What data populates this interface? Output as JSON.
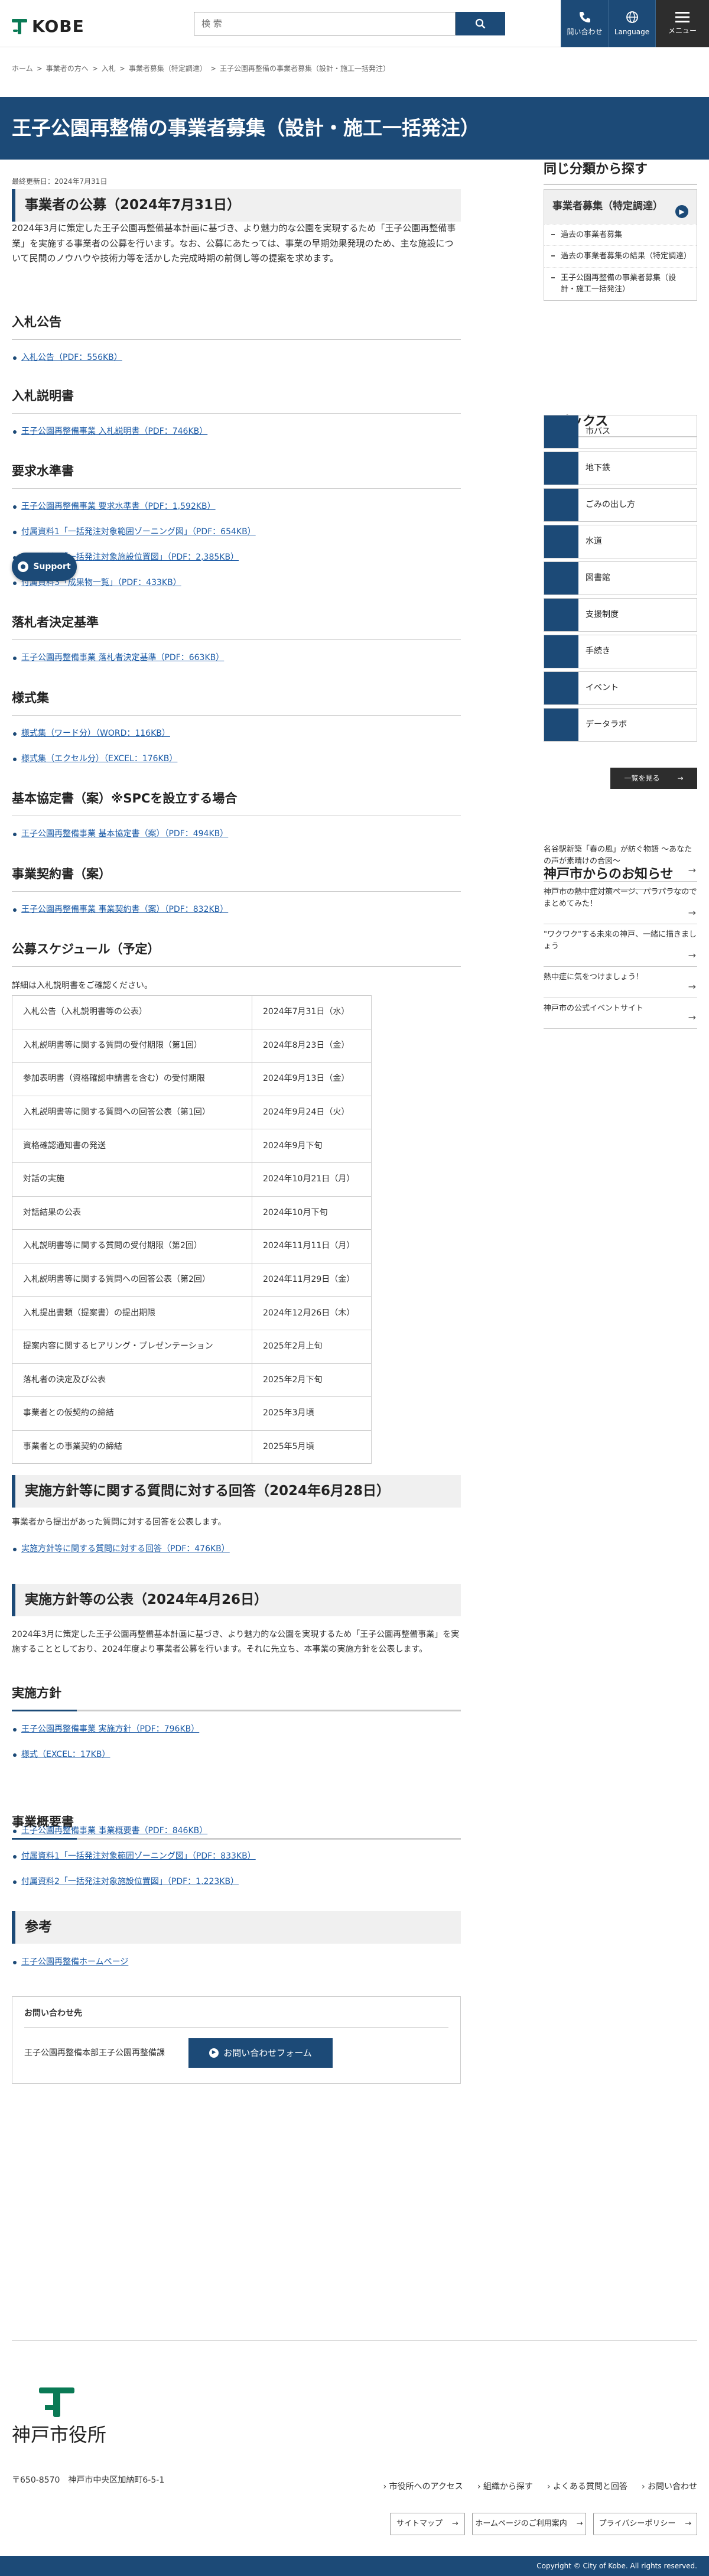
{
  "header": {
    "logo_text": "KOBE",
    "search_placeholder": "検 索",
    "buttons": [
      {
        "label": "問い合わせ",
        "icon": "phone-icon"
      },
      {
        "label": "Language",
        "icon": "globe-icon"
      },
      {
        "label": "メニュー",
        "icon": "menu-icon"
      }
    ]
  },
  "breadcrumb": [
    "ホーム",
    "事業者の方へ",
    "入札",
    "事業者募集（特定調達）",
    "王子公園再整備の事業者募集（設計・施工一括発注）"
  ],
  "page_title": "王子公園再整備の事業者募集（設計・施工一括発注）",
  "updated": "最終更新日：2024年7月31日",
  "sec1": {
    "title": "事業者の公募（2024年7月31日）",
    "para": "2024年3月に策定した王子公園再整備基本計画に基づき、より魅力的な公園を実現するため「王子公園再整備事業」を実施する事業者の公募を行います。なお、公募にあたっては、事業の早期効果発現のため、主な施設について民間のノウハウや技術力等を活かした完成時期の前倒し等の提案を求めます。"
  },
  "nyusatsu": {
    "title": "入札公告",
    "links": [
      "入札公告（PDF：556KB）"
    ]
  },
  "setsumei": {
    "title": "入札説明書",
    "links": [
      "王子公園再整備事業 入札説明書（PDF：746KB）"
    ]
  },
  "yokyu": {
    "title": "要求水準書",
    "links": [
      "王子公園再整備事業 要求水準書（PDF：1,592KB）",
      "付属資料1「一括発注対象範囲ゾーニング図」（PDF：654KB）",
      "付属資料2「一括発注対象施設位置図」（PDF：2,385KB）",
      "付属資料3「成果物一覧」（PDF：433KB）"
    ]
  },
  "rakusatsu": {
    "title": "落札者決定基準",
    "links": [
      "王子公園再整備事業 落札者決定基準（PDF：663KB）"
    ]
  },
  "yoshiki": {
    "title": "様式集",
    "links": [
      "様式集（ワード分）（WORD：116KB）",
      "様式集（エクセル分）（EXCEL：176KB）"
    ]
  },
  "kihon": {
    "title": "基本協定書（案）※SPCを設立する場合",
    "links": [
      "王子公園再整備事業 基本協定書（案）（PDF：494KB）"
    ]
  },
  "keiyaku": {
    "title": "事業契約書（案）",
    "links": [
      "王子公園再整備事業 事業契約書（案）（PDF：832KB）"
    ]
  },
  "schedule": {
    "title": "公募スケジュール（予定）",
    "note": "詳細は入札説明書をご確認ください。",
    "rows": [
      [
        "入札公告（入札説明書等の公表）",
        "2024年7月31日（水）"
      ],
      [
        "入札説明書等に関する質問の受付期限（第1回）",
        "2024年8月23日（金）"
      ],
      [
        "参加表明書（資格確認申請書を含む）の受付期限",
        "2024年9月13日（金）"
      ],
      [
        "入札説明書等に関する質問への回答公表（第1回）",
        "2024年9月24日（火）"
      ],
      [
        "資格確認通知書の発送",
        "2024年9月下旬"
      ],
      [
        "対話の実施",
        "2024年10月21日（月）"
      ],
      [
        "対話結果の公表",
        "2024年10月下旬"
      ],
      [
        "入札説明書等に関する質問の受付期限（第2回）",
        "2024年11月11日（月）"
      ],
      [
        "入札説明書等に関する質問への回答公表（第2回）",
        "2024年11月29日（金）"
      ],
      [
        "入札提出書類（提案書）の提出期限",
        "2024年12月26日（木）"
      ],
      [
        "提案内容に関するヒアリング・プレゼンテーション",
        "2025年2月上旬"
      ],
      [
        "落札者の決定及び公表",
        "2025年2月下旬"
      ],
      [
        "事業者との仮契約の締結",
        "2025年3月頃"
      ],
      [
        "事業者との事業契約の締結",
        "2025年5月頃"
      ]
    ]
  },
  "sec2": {
    "title": "実施方針等に関する質問に対する回答（2024年6月28日）",
    "para": "事業者から提出があった質問に対する回答を公表します。",
    "links": [
      "実施方針等に関する質問に対する回答（PDF：476KB）"
    ]
  },
  "sec3": {
    "title": "実施方針等の公表（2024年4月26日）",
    "para": "2024年3月に策定した王子公園再整備基本計画に基づき、より魅力的な公園を実現するため「王子公園再整備事業」を実施することとしており、2024年度より事業者公募を行います。それに先立ち、本事業の実施方針を公表します。"
  },
  "hoshin": {
    "title": "実施方針",
    "links": [
      "王子公園再整備事業 実施方針（PDF：796KB）",
      "様式（EXCEL：17KB）"
    ]
  },
  "gaiyo": {
    "title": "事業概要書",
    "links": [
      "王子公園再整備事業 事業概要書（PDF：846KB）",
      "付属資料1「一括発注対象範囲ゾーニング図」（PDF：833KB）",
      "付属資料2「一括発注対象施設位置図」（PDF：1,223KB）"
    ]
  },
  "ref": {
    "title": "参考",
    "links": [
      "王子公園再整備ホームページ"
    ]
  },
  "contact": {
    "heading": "お問い合わせ先",
    "dept": "王子公園再整備本部王子公園再整備課",
    "button": "お問い合わせフォーム"
  },
  "support": "Support",
  "side": {
    "cat_title": "同じ分類から探す",
    "cat_box": "事業者募集（特定調達）",
    "cat_items": [
      "過去の事業者募集",
      "過去の事業者募集の結果（特定調達）",
      "王子公園再整備の事業者募集（設計・施工一括発注）"
    ],
    "topics_title": "トピックス",
    "topics": [
      "市バス",
      "地下鉄",
      "ごみの出し方",
      "水道",
      "図書館",
      "支援制度",
      "手続き",
      "イベント",
      "データラボ"
    ],
    "more": "一覧を見る",
    "news_title": "神戸市からのお知らせ",
    "news": [
      "名谷駅新築「春の風」が紡ぐ物語 〜あなたの声が素晴けの合図〜",
      "神戸市の熱中症対策ページ、パラパラなのでまとめてみた！",
      "\"ワクワク\"する未来の神戸、一緒に描きましょう",
      "熱中症に気をつけましょう！",
      "神戸市の公式イベントサイト"
    ]
  },
  "footer": {
    "org": "神戸市役所",
    "address": "〒650-8570　神戸市中央区加納町6-5-1",
    "links": [
      "市役所へのアクセス",
      "組織から探す",
      "よくある質問と回答",
      "お問い合わせ"
    ],
    "buttons": [
      "サイトマップ",
      "ホームページのご利用案内",
      "プライバシーポリシー"
    ],
    "copyright": "Copyright © City of Kobe. All rights reserved."
  }
}
